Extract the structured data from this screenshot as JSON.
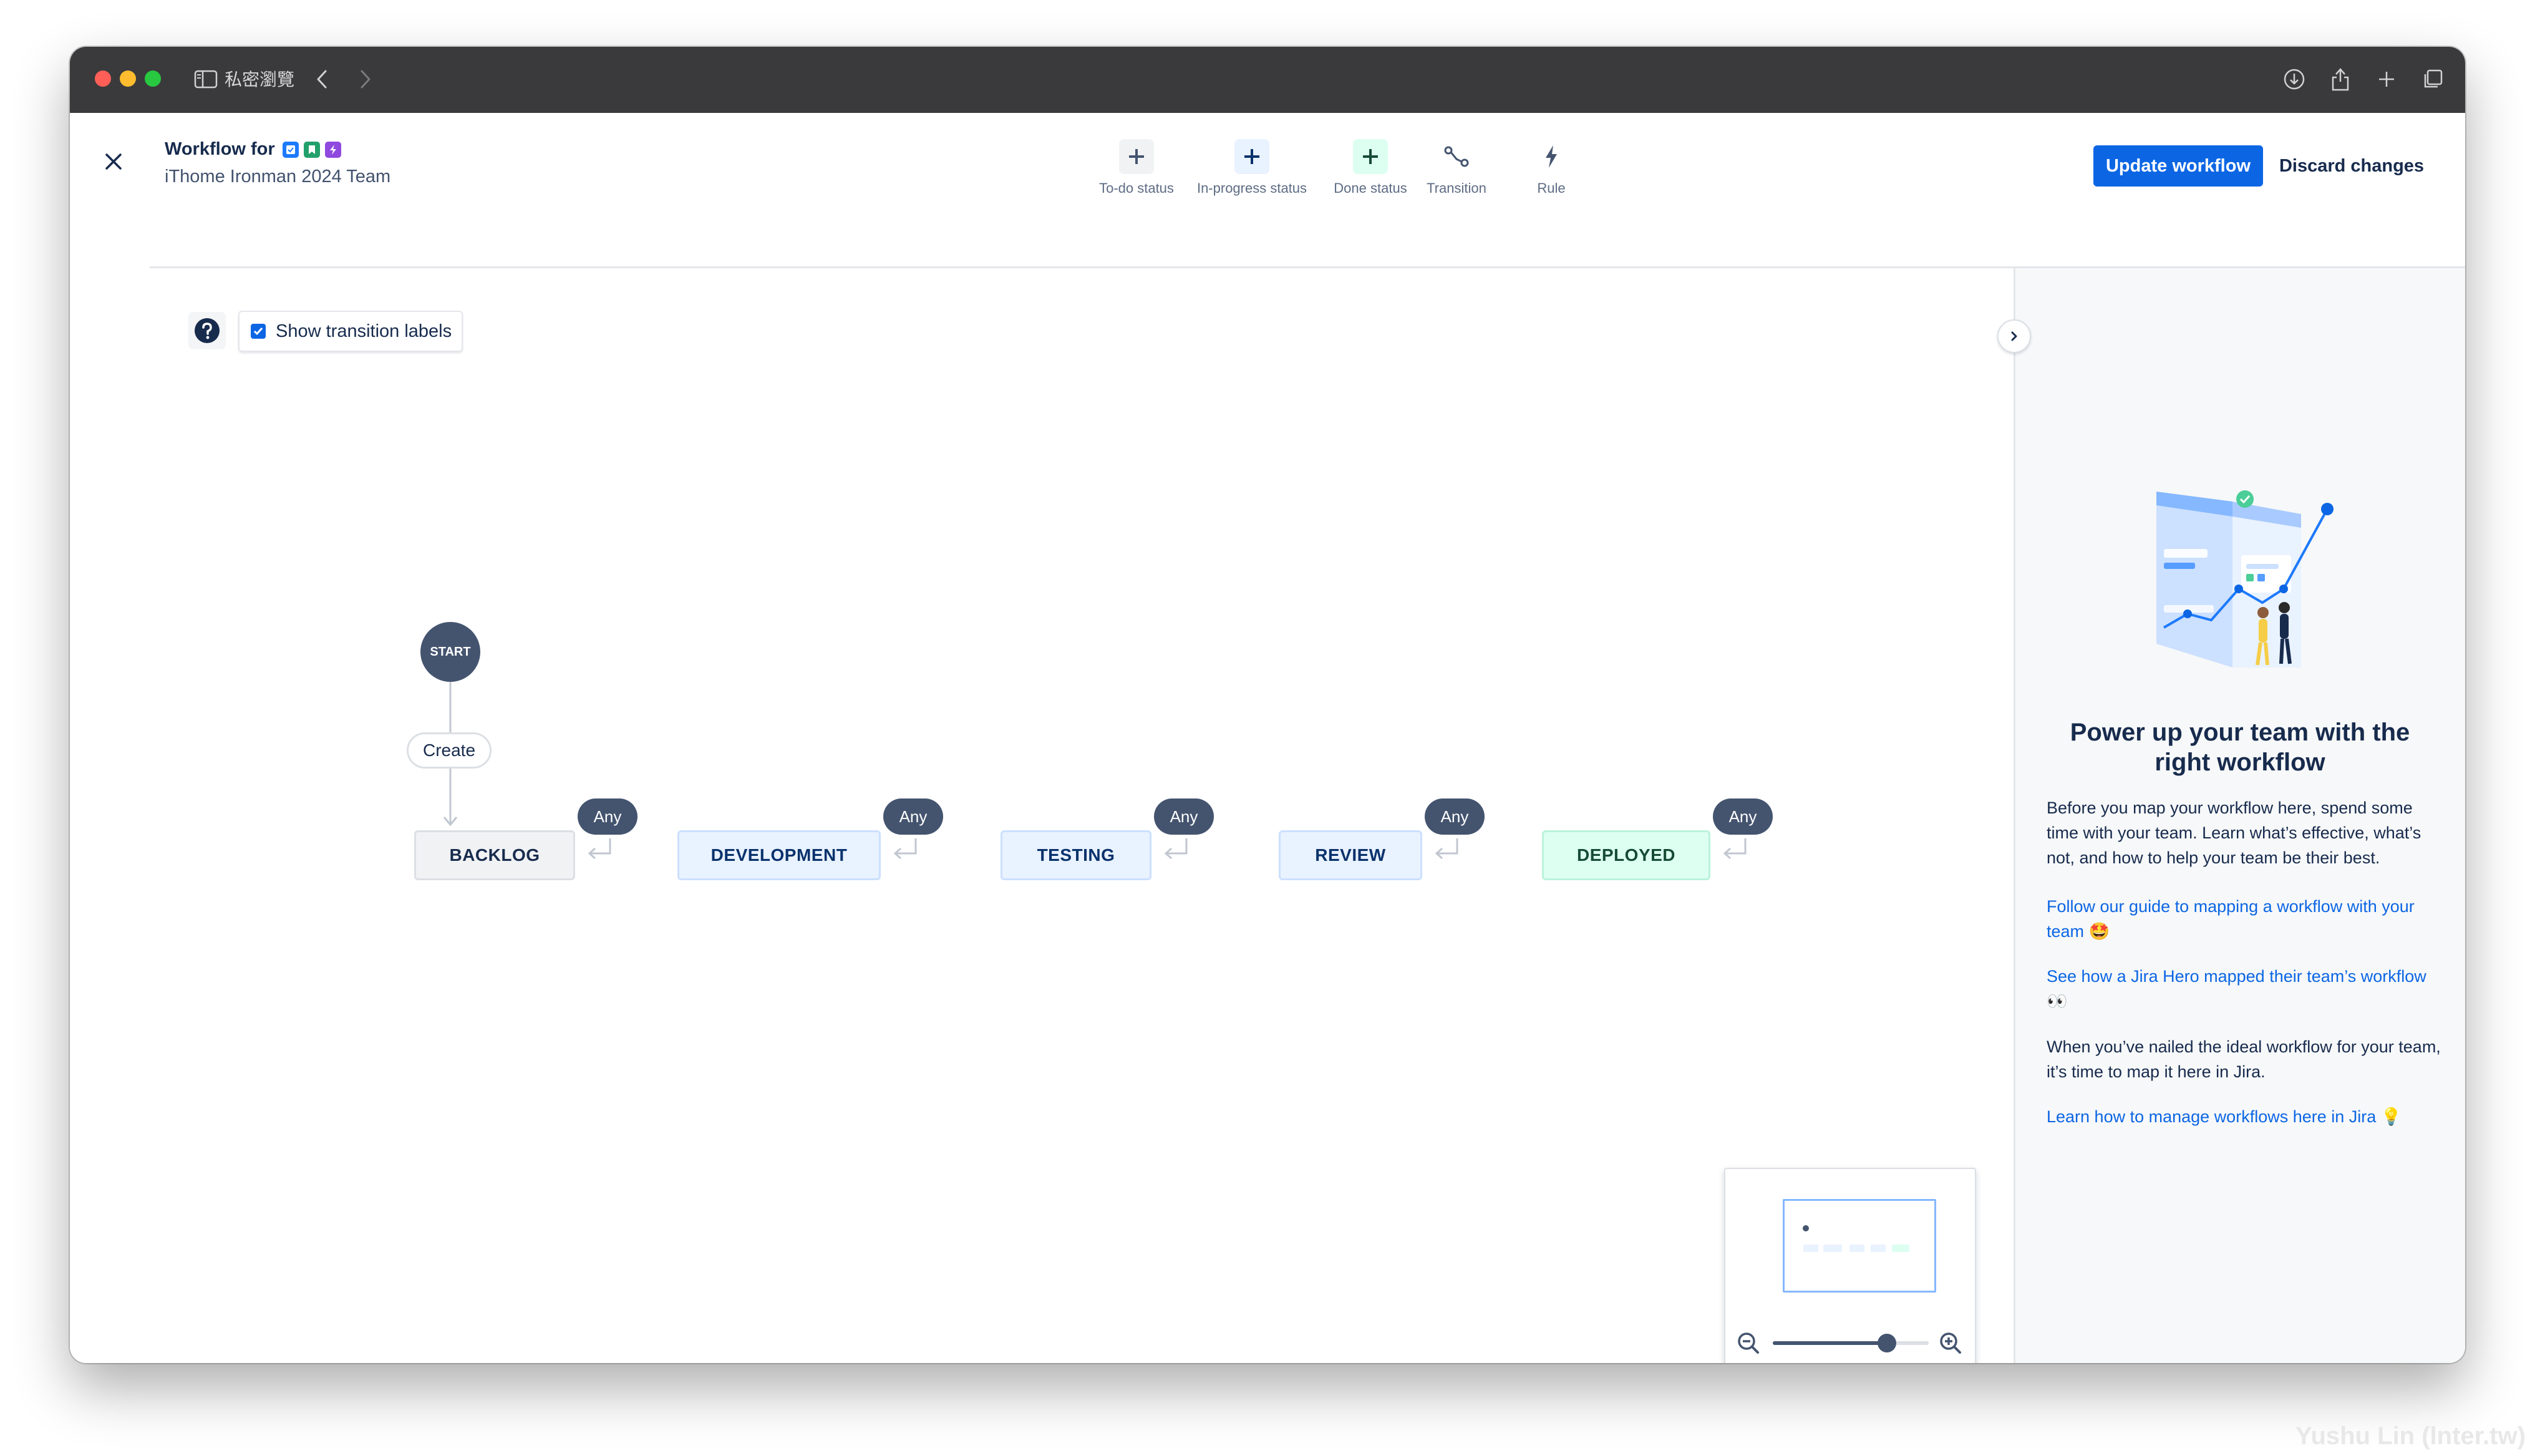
{
  "browser": {
    "tab_label": "私密瀏覽"
  },
  "header": {
    "title": "Workflow for",
    "project_name": "iThome Ironman 2024 Team",
    "update_button": "Update workflow",
    "discard_button": "Discard changes"
  },
  "toolbar": [
    {
      "label": "To-do status",
      "icon": "plus-icon"
    },
    {
      "label": "In-progress status",
      "icon": "plus-icon"
    },
    {
      "label": "Done status",
      "icon": "plus-icon"
    },
    {
      "label": "Transition",
      "icon": "transition-icon"
    },
    {
      "label": "Rule",
      "icon": "lightning-icon"
    }
  ],
  "canvas": {
    "show_transition_labels": "Show transition labels",
    "show_transition_labels_checked": true,
    "start_node": "START",
    "create_transition": "Create",
    "any_label": "Any",
    "statuses": [
      {
        "name": "BACKLOG",
        "category": "todo"
      },
      {
        "name": "DEVELOPMENT",
        "category": "in-progress"
      },
      {
        "name": "TESTING",
        "category": "in-progress"
      },
      {
        "name": "REVIEW",
        "category": "in-progress"
      },
      {
        "name": "DEPLOYED",
        "category": "done"
      }
    ]
  },
  "panel": {
    "title": "Power up your team with the right workflow",
    "intro": "Before you map your workflow here, spend some time with your team. Learn what’s effective, what’s not, and how to help your team be their best.",
    "link_guide": "Follow our guide to mapping a workflow with your team 🤩",
    "link_hero": "See how a Jira Hero mapped their team’s workflow 👀",
    "nailed": "When you’ve nailed the ideal workflow for your team, it’s time to map it here in Jira.",
    "link_manage": "Learn how to manage workflows here in Jira 💡"
  },
  "minimap": {
    "zoom_level": 0.73
  },
  "watermark": "Yushu Lin (lnter.tw)",
  "colors": {
    "primary": "#0c66e4",
    "todo": "#f1f2f4",
    "in_progress": "#e9f2ff",
    "done": "#dcfff1",
    "node_dark": "#44546f"
  }
}
